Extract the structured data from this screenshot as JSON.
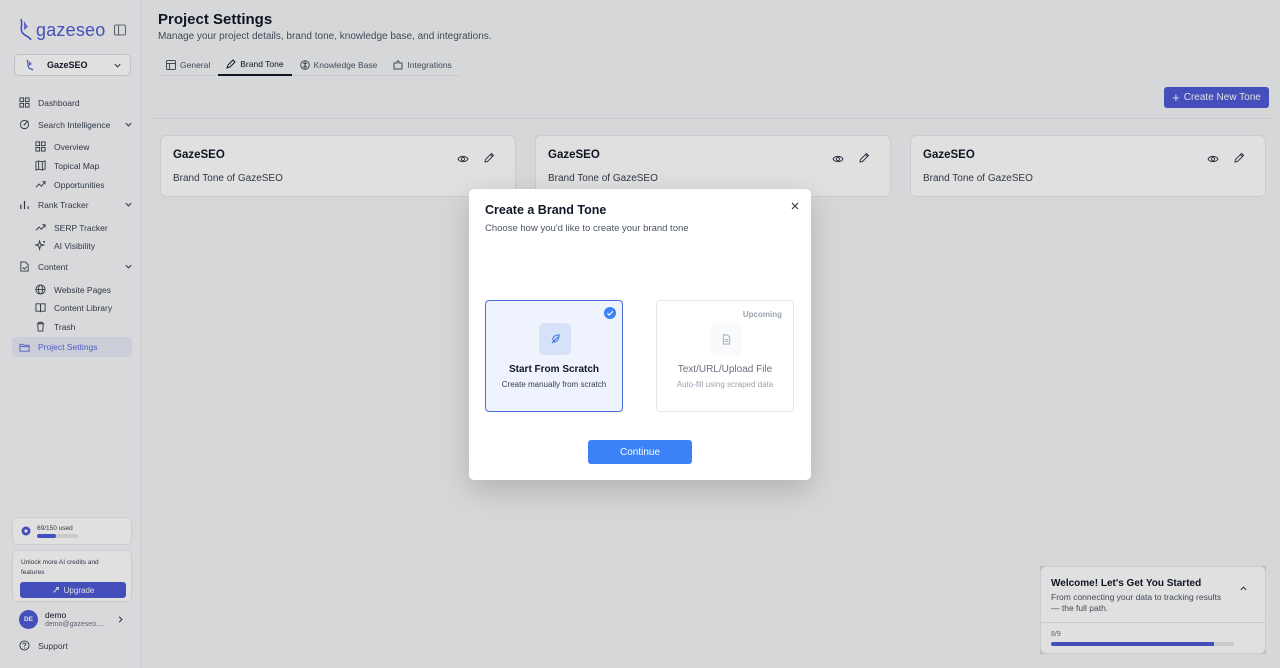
{
  "brand": {
    "name": "gazeseo",
    "accent": "#4f5bd5"
  },
  "project_selector": {
    "value": "GazeSEO"
  },
  "sidebar": {
    "items": [
      {
        "label": "Dashboard",
        "icon": "grid-icon"
      },
      {
        "label": "Search Intelligence",
        "icon": "radar-icon",
        "expanded": true,
        "children": [
          {
            "label": "Overview",
            "icon": "grid-icon"
          },
          {
            "label": "Topical Map",
            "icon": "map-icon"
          },
          {
            "label": "Opportunities",
            "icon": "trend-icon"
          }
        ]
      },
      {
        "label": "Rank Tracker",
        "icon": "bar-chart-icon",
        "expanded": true,
        "children": [
          {
            "label": "SERP Tracker",
            "icon": "trend-icon"
          },
          {
            "label": "AI Visibility",
            "icon": "sparkle-icon"
          }
        ]
      },
      {
        "label": "Content",
        "icon": "file-icon",
        "expanded": true,
        "children": [
          {
            "label": "Website Pages",
            "icon": "globe-icon"
          },
          {
            "label": "Content Library",
            "icon": "book-icon"
          },
          {
            "label": "Trash",
            "icon": "trash-icon"
          }
        ]
      },
      {
        "label": "Project Settings",
        "icon": "folder-icon",
        "active": true
      }
    ],
    "credits": {
      "label": "69/150 used",
      "fraction": 0.46
    },
    "upgrade": {
      "text": "Unlock more AI credits and features",
      "button": "Upgrade"
    },
    "user": {
      "initials": "DE",
      "name": "demo",
      "email": "demo@gazeseo...."
    },
    "support": "Support"
  },
  "header": {
    "title": "Project Settings",
    "subtitle": "Manage your project details, brand tone, knowledge base, and integrations."
  },
  "tabs": [
    {
      "label": "General",
      "icon": "layout-icon"
    },
    {
      "label": "Brand Tone",
      "icon": "pen-icon",
      "active": true
    },
    {
      "label": "Knowledge Base",
      "icon": "brain-icon"
    },
    {
      "label": "Integrations",
      "icon": "puzzle-icon"
    }
  ],
  "create_tone_button": "Create New Tone",
  "tone_cards": [
    {
      "name": "GazeSEO",
      "description": "Brand Tone of GazeSEO"
    },
    {
      "name": "GazeSEO",
      "description": "Brand Tone of GazeSEO"
    },
    {
      "name": "GazeSEO",
      "description": "Brand Tone of GazeSEO"
    }
  ],
  "modal": {
    "title": "Create a Brand Tone",
    "subtitle": "Choose how you'd like to create your brand tone",
    "options": [
      {
        "title": "Start From Scratch",
        "description": "Create manually from scratch",
        "selected": true
      },
      {
        "title": "Text/URL/Upload File",
        "description": "Auto-fill using scraped data",
        "badge": "Upcoming",
        "disabled": true
      }
    ],
    "continue_label": "Continue"
  },
  "onboarding": {
    "title": "Welcome! Let's Get You Started",
    "text": "From connecting your data to tracking results — the full path.",
    "progress_label": "8/9",
    "fraction": 0.889
  }
}
